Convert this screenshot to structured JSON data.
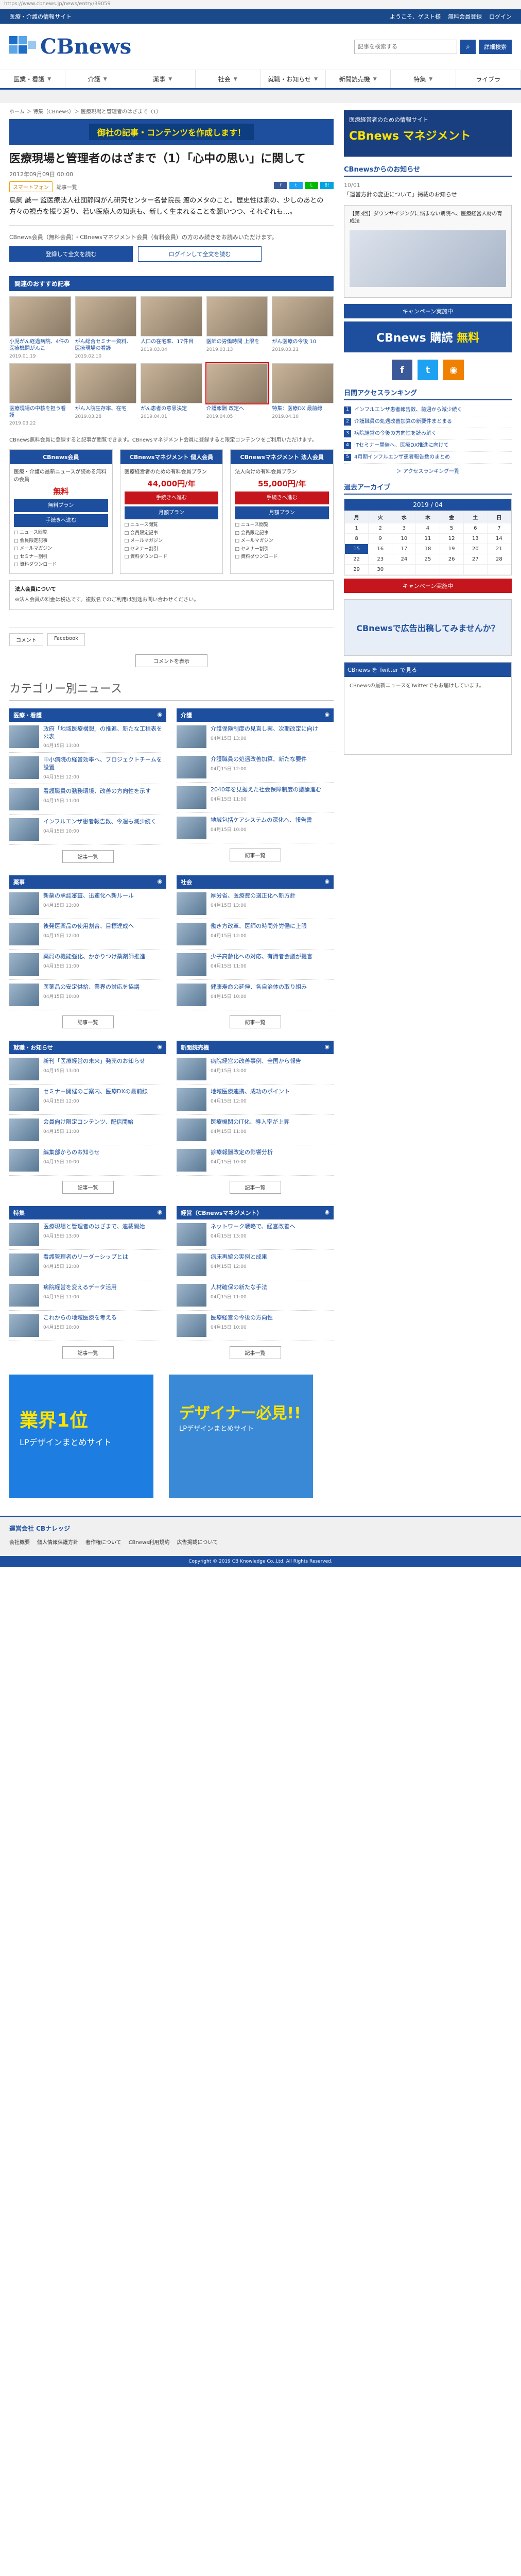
{
  "url": "https://www.cbnews.jp/news/entry/39059",
  "topstrip": {
    "left": "医療・介護の情報サイト",
    "welcome": "ようこそ、ゲスト様",
    "register": "無料会員登録",
    "login": "ログイン"
  },
  "header": {
    "logo": "CBnews",
    "search_placeholder": "記事を検索する",
    "advanced": "詳細検索"
  },
  "nav": [
    "医業・看護",
    "介護",
    "薬事",
    "社会",
    "就職・お知らせ",
    "新聞読売機",
    "特集",
    "ライブラ"
  ],
  "breadcrumb": "ホーム ＞ 特集（CBnews）＞ 医療現場と管理者のはざまで（1）",
  "promo": "御社の記事・コンテンツを作成します！",
  "article": {
    "title": "医療現場と管理者のはざまで（1）「心中の思い」に関して",
    "date": "2012年09月09日 00:00",
    "tag1": "スマートフォン",
    "tag2": "記事一覧",
    "lead": "鳥飼 誠一 監医療法人社団静岡がん研究センター名誉院長 渡のメタのこと。歴史性は素の、少しのあとの方々の視点を振り返り、若い医療人の知恵も、新しく生まれることを願いつつ、それぞれも…。",
    "paywall_text": "CBnews会員（無料会員）・CBnewsマネジメント会員（有料会員）の方のみ続きをお読みいただけます。",
    "btn_register": "登録して全文を読む",
    "btn_login": "ログインして全文を読む"
  },
  "recommended": {
    "header": "関連のおすすめ記事",
    "items": [
      {
        "title": "小児がん経過病院、4件の医療機関がんこ",
        "date": "2019.01.19"
      },
      {
        "title": "がん総合セミナー資料、医療現場の看護",
        "date": "2019.02.10"
      },
      {
        "title": "人口の在宅率、17件目",
        "date": "2019.03.04"
      },
      {
        "title": "医師の労働時間 上限を",
        "date": "2019.03.13"
      },
      {
        "title": "がん医療の今後 10",
        "date": "2019.03.21"
      },
      {
        "title": "医療現場の中核を担う看護",
        "date": "2019.03.22"
      },
      {
        "title": "がん入院生存率、在宅",
        "date": "2019.03.28"
      },
      {
        "title": "がん患者の意思決定",
        "date": "2019.04.01"
      },
      {
        "title": "介護報酬 改定へ",
        "date": "2019.04.05"
      },
      {
        "title": "特集：医療DX 最前線",
        "date": "2019.04.10"
      }
    ]
  },
  "plans": {
    "intro": "CBnews無料会員に登録すると記事が閲覧できます。CBnewsマネジメント会員に登録すると限定コンテンツをご利用いただけます。",
    "items": [
      {
        "name": "CBnews会員",
        "desc": "医療・介護の最新ニュースが読める無料の会員",
        "price": "無料",
        "btn1": "無料プラン",
        "btn2": "手続きへ進む"
      },
      {
        "name": "CBnewsマネジメント 個人会員",
        "desc": "医療経営者のための有料会員プラン",
        "price": "44,000円/年",
        "btn1": "手続きへ進む",
        "btn2": "月額プラン"
      },
      {
        "name": "CBnewsマネジメント 法人会員",
        "desc": "法人向けの有料会員プラン",
        "price": "55,000円/年",
        "btn1": "手続きへ進む",
        "btn2": "月額プラン"
      }
    ],
    "features": [
      "ニュース閲覧",
      "会員限定記事",
      "メールマガジン",
      "セミナー割引",
      "資料ダウンロード"
    ],
    "tax_title": "法人会員について",
    "tax_text": "※法人会員の料金は税込です。複数名でのご利用は別途お問い合わせください。"
  },
  "comments": {
    "comment": "コメント",
    "facebook": "Facebook",
    "show": "コメントを表示"
  },
  "catnews": {
    "heading": "カテゴリー別ニュース",
    "more": "記事一覧",
    "cats": [
      {
        "name": "医療・看護",
        "items": [
          {
            "t": "政府「地域医療構想」の推進、新たな工程表を公表",
            "d": "04月15日 13:00"
          },
          {
            "t": "中小病院の経営効率へ、プロジェクトチームを設置",
            "d": "04月15日 12:00"
          },
          {
            "t": "看護職員の勤務環境、改善の方向性を示す",
            "d": "04月15日 11:00"
          },
          {
            "t": "インフルエンザ患者報告数、今週も減少続く",
            "d": "04月15日 10:00"
          }
        ]
      },
      {
        "name": "介護",
        "items": [
          {
            "t": "介護保険制度の見直し案、次期改定に向け",
            "d": "04月15日 13:00"
          },
          {
            "t": "介護職員の処遇改善加算、新たな要件",
            "d": "04月15日 12:00"
          },
          {
            "t": "2040年を見据えた社会保障制度の議論進む",
            "d": "04月15日 11:00"
          },
          {
            "t": "地域包括ケアシステムの深化へ、報告書",
            "d": "04月15日 10:00"
          }
        ]
      },
      {
        "name": "薬事",
        "items": [
          {
            "t": "新薬の承認審査、迅速化へ新ルール",
            "d": "04月15日 13:00"
          },
          {
            "t": "後発医薬品の使用割合、目標達成へ",
            "d": "04月15日 12:00"
          },
          {
            "t": "薬局の機能強化、かかりつけ薬剤師推進",
            "d": "04月15日 11:00"
          },
          {
            "t": "医薬品の安定供給、業界の対応を協議",
            "d": "04月15日 10:00"
          }
        ]
      },
      {
        "name": "社会",
        "items": [
          {
            "t": "厚労省、医療費の適正化へ新方針",
            "d": "04月15日 13:00"
          },
          {
            "t": "働き方改革、医師の時間外労働に上限",
            "d": "04月15日 12:00"
          },
          {
            "t": "少子高齢化への対応、有識者会議が提言",
            "d": "04月15日 11:00"
          },
          {
            "t": "健康寿命の延伸、各自治体の取り組み",
            "d": "04月15日 10:00"
          }
        ]
      },
      {
        "name": "就職・お知らせ",
        "items": [
          {
            "t": "新刊「医療経営の未来」発売のお知らせ",
            "d": "04月15日 13:00"
          },
          {
            "t": "セミナー開催のご案内、医療DXの最前線",
            "d": "04月15日 12:00"
          },
          {
            "t": "会員向け限定コンテンツ、配信開始",
            "d": "04月15日 11:00"
          },
          {
            "t": "編集部からのお知らせ",
            "d": "04月15日 10:00"
          }
        ]
      },
      {
        "name": "新聞読売機",
        "items": [
          {
            "t": "病院経営の改善事例、全国から報告",
            "d": "04月15日 13:00"
          },
          {
            "t": "地域医療連携、成功のポイント",
            "d": "04月15日 12:00"
          },
          {
            "t": "医療機関のIT化、導入率が上昇",
            "d": "04月15日 11:00"
          },
          {
            "t": "診療報酬改定の影響分析",
            "d": "04月15日 10:00"
          }
        ]
      },
      {
        "name": "特集",
        "items": [
          {
            "t": "医療現場と管理者のはざまで、連載開始",
            "d": "04月15日 13:00"
          },
          {
            "t": "看護管理者のリーダーシップとは",
            "d": "04月15日 12:00"
          },
          {
            "t": "病院経営を変えるデータ活用",
            "d": "04月15日 11:00"
          },
          {
            "t": "これからの地域医療を考える",
            "d": "04月15日 10:00"
          }
        ]
      },
      {
        "name": "経営（CBnewsマネジメント）",
        "items": [
          {
            "t": "ネットワーク戦略で、経営改善へ",
            "d": "04月15日 13:00"
          },
          {
            "t": "病床再編の実例と成果",
            "d": "04月15日 12:00"
          },
          {
            "t": "人材確保の新たな手法",
            "d": "04月15日 11:00"
          },
          {
            "t": "医療経営の今後の方向性",
            "d": "04月15日 10:00"
          }
        ]
      }
    ]
  },
  "footer_ads": {
    "ad1_big": "業界1位",
    "ad1_sub": "LPデザインまとめサイト",
    "ad2_big": "デザイナー必見!!",
    "ad2_sub": "LPデザインまとめサイト"
  },
  "sidebar": {
    "ad1_t1": "医療経営者のための情報サイト",
    "ad1_t2": "CBnews マネジメント",
    "notice_title": "CBnewsからのお知らせ",
    "notice_date": "10/01",
    "notice_text": "「運営方針の変更について」掲載のお知らせ",
    "video_title": "【第3回】ダウンサイジングに悩まない病院へ、医療経営人材の育成法",
    "btn1": "キャンペーン実施中",
    "btn2": "キャンペーン実施中",
    "ad2": "CBnews 購読",
    "ad2b": "無料",
    "rank_title": "日間アクセスランキング",
    "ranking": [
      "インフルエンザ患者報告数、前週から減少続く",
      "介護職員の処遇改善加算の新要件まとまる",
      "病院経営の今後の方向性を読み解く",
      "ITセミナー開催へ、医療DX推進に向けて",
      "4月期インフルエンザ患者報告数のまとめ"
    ],
    "rank_more": "＞ アクセスランキング一覧",
    "cal_title": "過去アーカイブ",
    "cal_month": "2019 / 04",
    "cal_days": [
      "月",
      "火",
      "水",
      "木",
      "金",
      "土",
      "日"
    ],
    "cal_weeks": [
      [
        "1",
        "2",
        "3",
        "4",
        "5",
        "6",
        "7"
      ],
      [
        "8",
        "9",
        "10",
        "11",
        "12",
        "13",
        "14"
      ],
      [
        "15",
        "16",
        "17",
        "18",
        "19",
        "20",
        "21"
      ],
      [
        "22",
        "23",
        "24",
        "25",
        "26",
        "27",
        "28"
      ],
      [
        "29",
        "30",
        "",
        "",
        "",
        "",
        ""
      ]
    ],
    "cal_today": "15",
    "ad3": "CBnewsで広告出稿してみませんか？",
    "tw_title": "CBnews を Twitter で見る",
    "tw_text": "CBnewsの最新ニュースをTwitterでもお届けしています。"
  },
  "footer": {
    "name": "運営会社 CBナレッジ",
    "links": [
      "会社概要",
      "個人情報保護方針",
      "著作権について",
      "CBnews利用規約",
      "広告掲載について"
    ],
    "copyright": "Copyright © 2019 CB Knowledge Co.,Ltd. All Rights Reserved."
  }
}
